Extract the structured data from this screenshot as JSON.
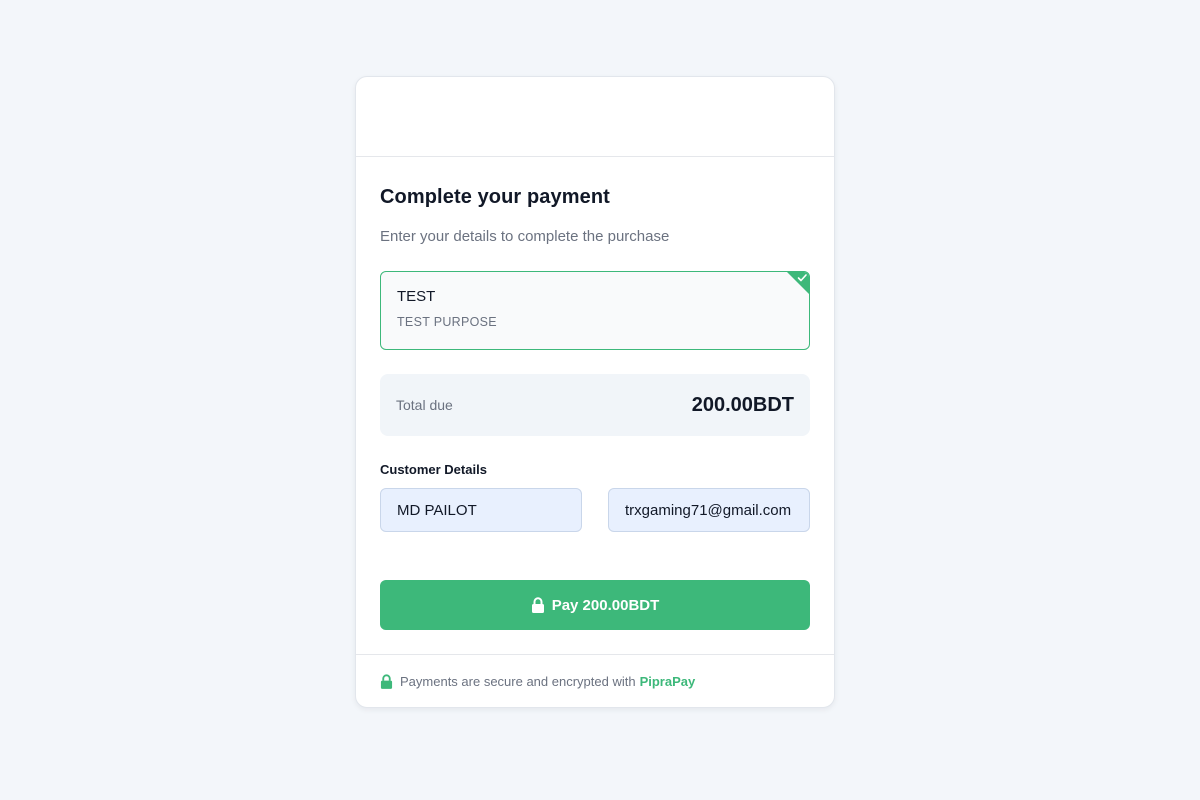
{
  "checkout": {
    "title": "Complete your payment",
    "subtitle": "Enter your details to complete the purchase"
  },
  "product": {
    "name": "TEST",
    "description": "TEST PURPOSE",
    "selected": true
  },
  "total": {
    "label": "Total due",
    "amount": "200.00BDT"
  },
  "customer": {
    "section_label": "Customer Details",
    "name_value": "MD PAILOT",
    "email_value": "trxgaming71@gmail.com"
  },
  "pay_button": {
    "label": "Pay 200.00BDT",
    "icon": "lock-icon"
  },
  "footer": {
    "text": "Payments are secure and encrypted with",
    "brand": "PipraPay",
    "icon": "lock-icon"
  },
  "colors": {
    "accent": "#3db87a",
    "background": "#f3f6fa",
    "input_bg": "#e8f0fe"
  }
}
